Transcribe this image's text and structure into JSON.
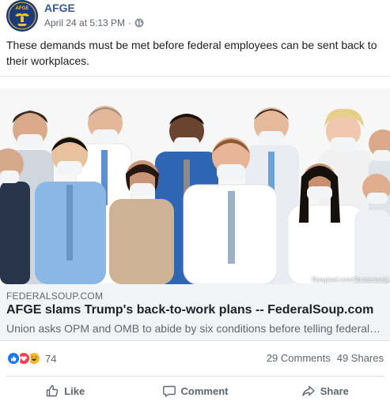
{
  "post": {
    "author": "AFGE",
    "avatar_text": "AFGE",
    "timestamp": "April 24 at 5:13 PM",
    "separator": "·",
    "privacy_icon": "globe-icon",
    "text": "These demands must be met before federal employees can be sent back to their workplaces."
  },
  "link": {
    "image_credit": "Rawpixel.com/Shutterstock",
    "domain": "FEDERALSOUP.COM",
    "title": "AFGE slams Trump's back-to-work plans -- FederalSoup.com",
    "description": "Union asks OPM and OMB to abide by six conditions before telling federal employees to return to work"
  },
  "stats": {
    "reaction_icons": [
      "like-reaction-icon",
      "love-reaction-icon",
      "haha-reaction-icon"
    ],
    "reaction_count": "74",
    "comments": "29 Comments",
    "shares": "49 Shares"
  },
  "actions": {
    "like": "Like",
    "comment": "Comment",
    "share": "Share"
  },
  "colors": {
    "author_link": "#385898",
    "like_blue": "#1877f2",
    "love_red": "#f33e58",
    "haha_yellow": "#f7b928",
    "avatar_navy": "#1d3a7a",
    "avatar_gold": "#f2c231"
  }
}
